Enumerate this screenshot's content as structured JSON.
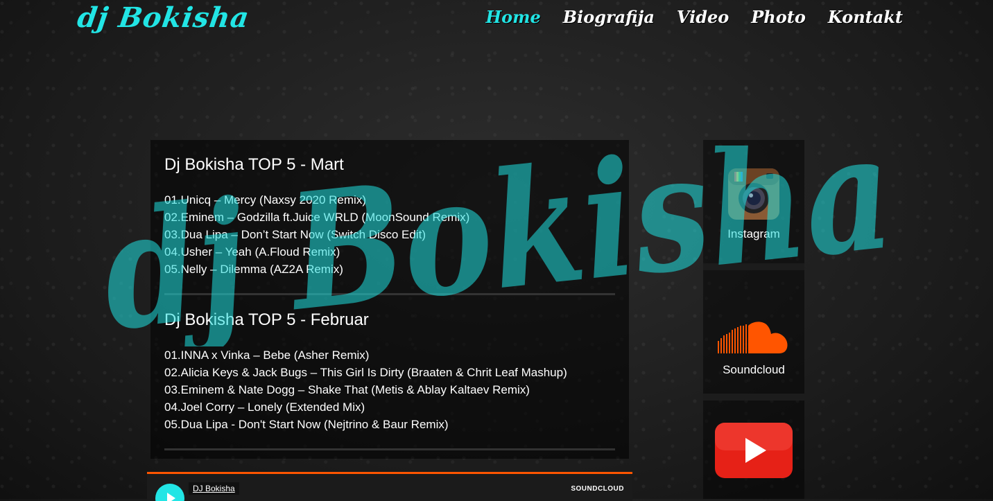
{
  "header": {
    "logo": "dj Bokisha",
    "nav": [
      "Home",
      "Biografija",
      "Video",
      "Photo",
      "Kontakt"
    ],
    "active_nav": "Home"
  },
  "charts": [
    {
      "title": "Dj Bokisha TOP 5 - Mart",
      "tracks": [
        "01.Unicq – Mercy (Naxsy 2020 Remix)",
        "02.Eminem – Godzilla ft.Juice WRLD (MoonSound Remix)",
        "03.Dua Lipa – Don’t Start Now (Switch Disco Edit)",
        "04.Usher – Yeah (A.Floud Remix)",
        "05.Nelly – Dilemma (AZ2A Remix)"
      ]
    },
    {
      "title": "Dj Bokisha TOP 5 - Februar",
      "tracks": [
        "01.INNA x Vinka – Bebe (Asher Remix)",
        "02.Alicia Keys & Jack Bugs – This Girl Is Dirty (Braaten & Chrit Leaf Mashup)",
        "03.Eminem & Nate Dogg – Shake That (Metis & Ablay Kaltaev Remix)",
        "04.Joel Corry – Lonely (Extended Mix)",
        "05.Dua Lipa - Don't Start Now (Nejtrino & Baur Remix)"
      ]
    }
  ],
  "social": [
    {
      "label": "Instagram",
      "icon": "instagram-icon"
    },
    {
      "label": "Soundcloud",
      "icon": "soundcloud-icon"
    },
    {
      "label": "",
      "icon": "youtube-icon"
    }
  ],
  "overlay_text": "dj Bokisha",
  "player": {
    "artist": "DJ Bokisha",
    "brand": "SOUNDCLOUD"
  },
  "colors": {
    "accent": "#22e5e5",
    "soundcloud": "#ff5500",
    "youtube": "#e62117"
  }
}
